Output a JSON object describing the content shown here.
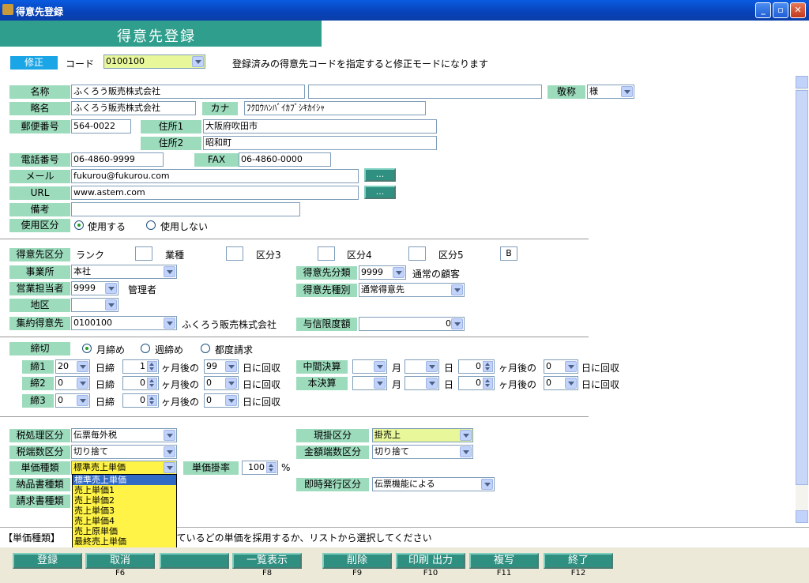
{
  "window": {
    "title": "得意先登録",
    "min": "_",
    "max": "▫",
    "close": "✕"
  },
  "banner": "得意先登録",
  "mode": {
    "label": "修正",
    "code_label": "コード",
    "code": "0100100",
    "hint": "登録済みの得意先コードを指定すると修正モードになります"
  },
  "basic": {
    "name_label": "名称",
    "name": "ふくろう販売株式会社",
    "name2": "",
    "honorific_label": "敬称",
    "honorific": "様",
    "short_label": "略名",
    "short": "ふくろう販売株式会社",
    "kana_label": "カナ",
    "kana": "ﾌｸﾛｳﾊﾝﾊﾞｲｶﾌﾞｼｷｶｲｼｬ",
    "zip_label": "郵便番号",
    "zip": "564-0022",
    "addr1_label": "住所1",
    "addr1": "大阪府吹田市",
    "addr2_label": "住所2",
    "addr2": "昭和町",
    "tel_label": "電話番号",
    "tel": "06-4860-9999",
    "fax_label": "FAX",
    "fax": "06-4860-0000",
    "mail_label": "メール",
    "mail": "fukurou@fukurou.com",
    "url_label": "URL",
    "url": "www.astem.com",
    "dots": "...",
    "note_label": "備考",
    "note": "",
    "use_label": "使用区分",
    "use_on": "使用する",
    "use_off": "使用しない"
  },
  "cls": {
    "label": "得意先区分",
    "rank": "ランク",
    "industry": "業種",
    "k3": "区分3",
    "k4": "区分4",
    "k5": "区分5",
    "k5val": "B",
    "office_label": "事業所",
    "office": "本社",
    "rep_label": "営業担当者",
    "rep": "9999",
    "rep_name": "管理者",
    "area_label": "地区",
    "area": "",
    "agg_label": "集約得意先",
    "agg": "0100100",
    "agg_name": "ふくろう販売株式会社",
    "type_label": "得意先分類",
    "type": "9999",
    "type_name": "通常の顧客",
    "kind_label": "得意先種別",
    "kind": "通常得意先",
    "credit_label": "与信限度額",
    "credit": "0"
  },
  "closing": {
    "label": "締切",
    "opt1": "月締め",
    "opt2": "週締め",
    "opt3": "都度請求",
    "rows": [
      {
        "label": "締1",
        "day": "20",
        "shime": "日締",
        "months": "1",
        "after": "ヶ月後の",
        "payday": "99",
        "collect": "日に回収"
      },
      {
        "label": "締2",
        "day": "0",
        "shime": "日締",
        "months": "0",
        "after": "ヶ月後の",
        "payday": "0",
        "collect": "日に回収"
      },
      {
        "label": "締3",
        "day": "0",
        "shime": "日締",
        "months": "0",
        "after": "ヶ月後の",
        "payday": "0",
        "collect": "日に回収"
      }
    ],
    "mid_label": "中間決算",
    "final_label": "本決算",
    "month": "月",
    "day": "日",
    "zero": "0",
    "after": "ヶ月後の",
    "collect": "日に回収"
  },
  "tax": {
    "proc_label": "税処理区分",
    "proc": "伝票毎外税",
    "round_label": "税端数区分",
    "round": "切り捨て",
    "price_label": "単価種類",
    "price": "標準売上単価",
    "rate_label": "単価掛率",
    "rate": "100",
    "pct": "%",
    "deliv_label": "納品書種類",
    "bill_label": "請求書種類",
    "cash_label": "現掛区分",
    "cash": "掛売上",
    "amt_label": "金額端数区分",
    "amt": "切り捨て",
    "imm_label": "即時発行区分",
    "imm": "伝票機能による"
  },
  "price_options": [
    "標準売上単価",
    "売上単価1",
    "売上単価2",
    "売上単価3",
    "売上単価4",
    "売上原単価",
    "最終売上単価"
  ],
  "status": {
    "prefix": "【単価種類】",
    "text": "れているどの単価を採用するか、リストから選択してください"
  },
  "fbuttons": [
    {
      "label": "登録",
      "key": ""
    },
    {
      "label": "取消",
      "key": "F6"
    },
    {
      "label": "",
      "key": ""
    },
    {
      "label": "一覧表示",
      "key": "F8"
    },
    {
      "label": "削除",
      "key": "F9"
    },
    {
      "label": "印刷 出力",
      "key": "F10"
    },
    {
      "label": "複写",
      "key": "F11"
    },
    {
      "label": "終了",
      "key": "F12"
    }
  ],
  "colors": {
    "title": "#0a5be0",
    "banner": "#2f9e8c",
    "label": "#9ddbbd",
    "button": "#2f8f80",
    "highlight": "#fff347"
  }
}
